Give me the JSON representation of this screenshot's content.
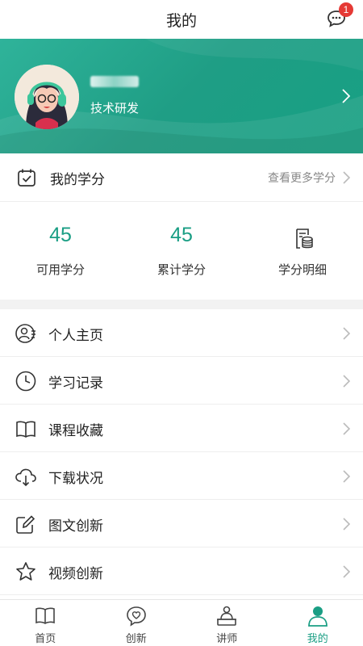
{
  "header": {
    "title": "我的",
    "message_badge": "1"
  },
  "profile": {
    "department": "技术研发"
  },
  "credits": {
    "title": "我的学分",
    "more_label": "查看更多学分",
    "available": {
      "value": "45",
      "label": "可用学分"
    },
    "accumulated": {
      "value": "45",
      "label": "累计学分"
    },
    "details": {
      "label": "学分明细"
    }
  },
  "menu": {
    "items": [
      {
        "label": "个人主页",
        "icon": "profile-icon"
      },
      {
        "label": "学习记录",
        "icon": "clock-icon"
      },
      {
        "label": "课程收藏",
        "icon": "book-icon"
      },
      {
        "label": "下载状况",
        "icon": "cloud-download-icon"
      },
      {
        "label": "图文创新",
        "icon": "edit-icon"
      },
      {
        "label": "视频创新",
        "icon": "star-icon"
      }
    ]
  },
  "nav": {
    "items": [
      {
        "label": "首页",
        "icon": "book-icon"
      },
      {
        "label": "创新",
        "icon": "heart-chat-icon"
      },
      {
        "label": "讲师",
        "icon": "teacher-icon"
      },
      {
        "label": "我的",
        "icon": "user-icon"
      }
    ]
  },
  "colors": {
    "accent": "#1a9e84",
    "banner": "#1f9e85",
    "badge": "#e53935"
  }
}
